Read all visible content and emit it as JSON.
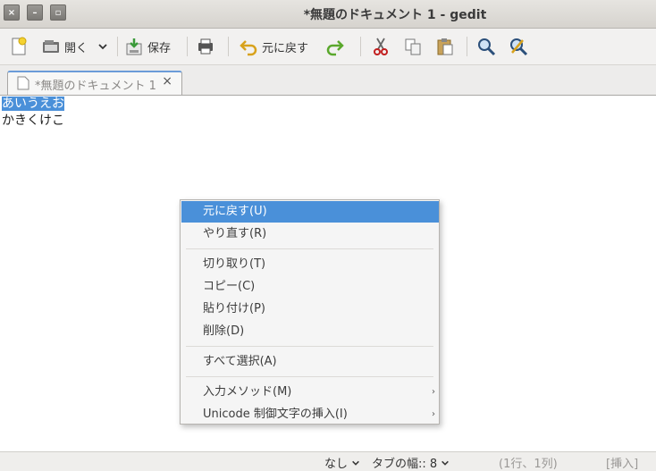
{
  "window": {
    "title": "*無題のドキュメント 1 - gedit",
    "buttons": {
      "close": "×",
      "minimize": "–",
      "maximize": "▫"
    }
  },
  "toolbar": {
    "open_label": "開く",
    "save_label": "保存",
    "undo_label": "元に戻す",
    "icons": [
      "new-document-icon",
      "open-icon",
      "save-icon",
      "print-icon",
      "undo-icon",
      "redo-icon",
      "cut-icon",
      "copy-icon",
      "paste-icon",
      "find-icon",
      "replace-icon"
    ]
  },
  "tab": {
    "label": "*無題のドキュメント 1",
    "close": "×"
  },
  "editor": {
    "lines": [
      {
        "text": "あいうえお",
        "selected": true
      },
      {
        "text": "かきくけこ",
        "selected": false
      }
    ]
  },
  "context_menu": {
    "items": [
      {
        "label": "元に戻す(U)",
        "highlighted": true
      },
      {
        "label": "やり直す(R)"
      },
      {
        "label": "切り取り(T)"
      },
      {
        "label": "コピー(C)"
      },
      {
        "label": "貼り付け(P)"
      },
      {
        "label": "削除(D)"
      },
      {
        "label": "すべて選択(A)"
      },
      {
        "label": "入力メソッド(M)",
        "submenu": true
      },
      {
        "label": "Unicode 制御文字の挿入(I)",
        "submenu": true
      }
    ],
    "submenu_arrow": "›"
  },
  "statusbar": {
    "language": "なし",
    "tab_width_label": "タブの幅::",
    "tab_width_value": "8",
    "position": "(1行、1列)",
    "mode": "[挿入]"
  },
  "colors": {
    "selection": "#4a90d9",
    "tab_accent": "#6b9bd8"
  }
}
